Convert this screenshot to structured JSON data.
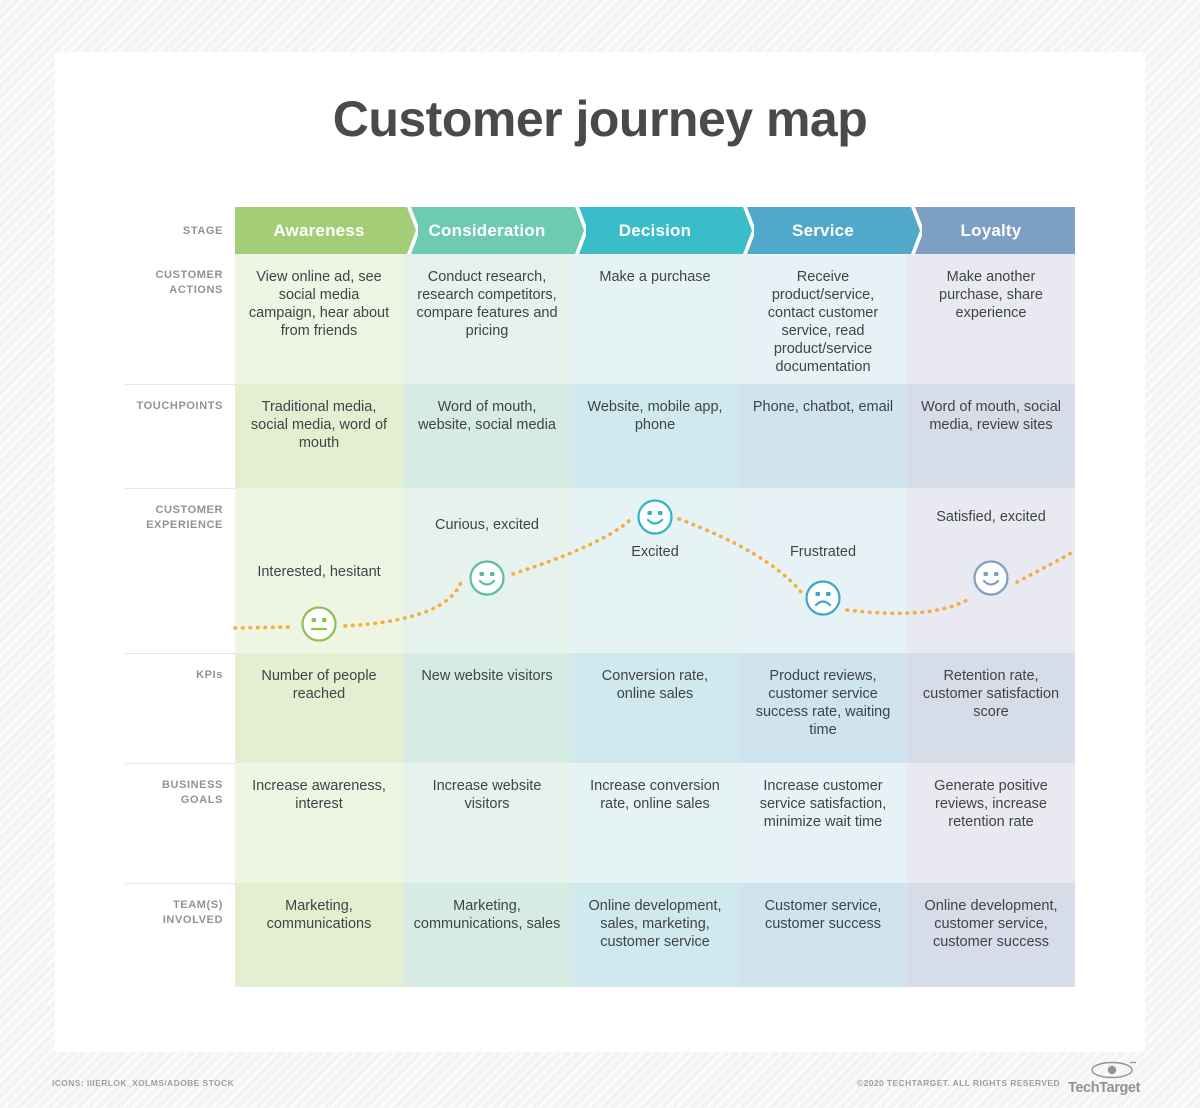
{
  "title": "Customer journey map",
  "stage_label": "STAGE",
  "stages": [
    {
      "name": "Awareness",
      "header_color": "#a3ce77",
      "tint_a": "#eef5e3",
      "tint_b": "#e4efd2",
      "face_color": "#8cc152"
    },
    {
      "name": "Consideration",
      "header_color": "#6ecbb0",
      "tint_a": "#e6f3ec",
      "tint_b": "#d6ebe2",
      "face_color": "#56bfa0"
    },
    {
      "name": "Decision",
      "header_color": "#3bbcc9",
      "tint_a": "#e5f3f5",
      "tint_b": "#cfe9ee",
      "face_color": "#2fb5c4"
    },
    {
      "name": "Service",
      "header_color": "#52a8c9",
      "tint_a": "#e6f2f5",
      "tint_b": "#cfe4ee",
      "face_color": "#3da5c8"
    },
    {
      "name": "Loyalty",
      "header_color": "#7e9fc4",
      "tint_a": "#e9e9f1",
      "tint_b": "#d7dce9",
      "face_color": "#7e9fc4"
    }
  ],
  "rows": [
    {
      "label": "CUSTOMER ACTIONS",
      "cells": [
        "View online ad, see social media campaign, hear about from friends",
        "Conduct research, research competitors, compare features and pricing",
        "Make a purchase",
        "Receive product/service, contact customer service, read product/service documentation",
        "Make another purchase, share experience"
      ]
    },
    {
      "label": "TOUCHPOINTS",
      "cells": [
        "Traditional media, social media, word of mouth",
        "Word of mouth, website, social media",
        "Website, mobile app, phone",
        "Phone, chatbot, email",
        "Word of mouth, social media, review sites"
      ]
    },
    {
      "label": "CUSTOMER EXPERIENCE",
      "cells": [
        "Interested, hesitant",
        "Curious, excited",
        "Excited",
        "Frustrated",
        "Satisfied, excited"
      ]
    },
    {
      "label": "KPIs",
      "cells": [
        "Number of people reached",
        "New website visitors",
        "Conversion rate, online sales",
        "Product reviews, customer service success rate, waiting time",
        "Retention rate, customer satisfaction score"
      ]
    },
    {
      "label": "BUSINESS GOALS",
      "cells": [
        "Increase awareness, interest",
        "Increase website visitors",
        "Increase conversion rate, online sales",
        "Increase customer service satisfaction, minimize wait time",
        "Generate positive reviews, increase retention rate"
      ]
    },
    {
      "label": "TEAM(S) INVOLVED",
      "cells": [
        "Marketing, communications",
        "Marketing, communications, sales",
        "Online development, sales, marketing, customer service",
        "Customer service, customer success",
        "Online development, customer service, customer success"
      ]
    }
  ],
  "experience": {
    "curve_color": "#f5ae3c",
    "faces": [
      {
        "mood": "neutral",
        "label": "Interested, hesitant"
      },
      {
        "mood": "happy",
        "label": "Curious, excited"
      },
      {
        "mood": "happy",
        "label": "Excited"
      },
      {
        "mood": "sad",
        "label": "Frustrated"
      },
      {
        "mood": "happy",
        "label": "Satisfied, excited"
      }
    ]
  },
  "footer": {
    "credit": "ICONS: IIIERLOK_XOLMS/ADOBE STOCK",
    "copyright": "©2020 TECHTARGET. ALL RIGHTS RESERVED",
    "brand": "TechTarget"
  }
}
